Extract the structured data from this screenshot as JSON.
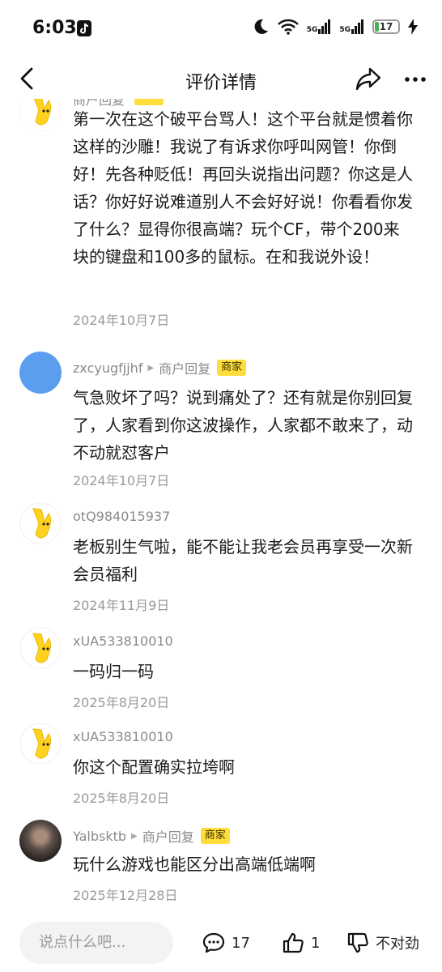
{
  "status": {
    "time": "6:03",
    "network1": "5G",
    "network2": "5G",
    "battery": "17",
    "battery_level": 0.17
  },
  "nav": {
    "title": "评价详情"
  },
  "comments": [
    {
      "user": "商户回复",
      "role": "",
      "badge": "",
      "text": "第一次在这个破平台骂人！这个平台就是惯着你这样的沙雕！我说了有诉求你呼叫网管！你倒好！先各种贬低！再回头说指出问题？你这是人话？你好好说难道别人不会好好说！你看看你发了什么？显得你很高端？玩个CF，带个200来块的键盘和100多的鼠标。在和我说外设！",
      "date": "2024年10月7日",
      "avatar": "yellow-hand"
    },
    {
      "user": "zxcyugfjjhf",
      "role": "商户回复",
      "badge": "商家",
      "text": "气急败坏了吗？说到痛处了？还有就是你别回复了，人家看到你这波操作，人家都不敢来了，动不动就怼客户",
      "date": "2024年10月7日",
      "avatar": "blue"
    },
    {
      "user": "otQ984015937",
      "role": "",
      "badge": "",
      "text": "老板别生气啦，能不能让我老会员再享受一次新会员福利",
      "date": "2024年11月9日",
      "avatar": "yellow-hand"
    },
    {
      "user": "xUA533810010",
      "role": "",
      "badge": "",
      "text": "一码归一码",
      "date": "2025年8月20日",
      "avatar": "yellow-hand"
    },
    {
      "user": "xUA533810010",
      "role": "",
      "badge": "",
      "text": "你这个配置确实拉垮啊",
      "date": "2025年8月20日",
      "avatar": "yellow-hand"
    },
    {
      "user": "Yalbsktb",
      "role": "商户回复",
      "badge": "商家",
      "text": "玩什么游戏也能区分出高端低端啊",
      "date": "2025年12月28日",
      "avatar": "photo"
    }
  ],
  "bottom": {
    "input_placeholder": "说点什么吧...",
    "comment_count": "17",
    "like_count": "1",
    "dislike_label": "不对劲"
  }
}
